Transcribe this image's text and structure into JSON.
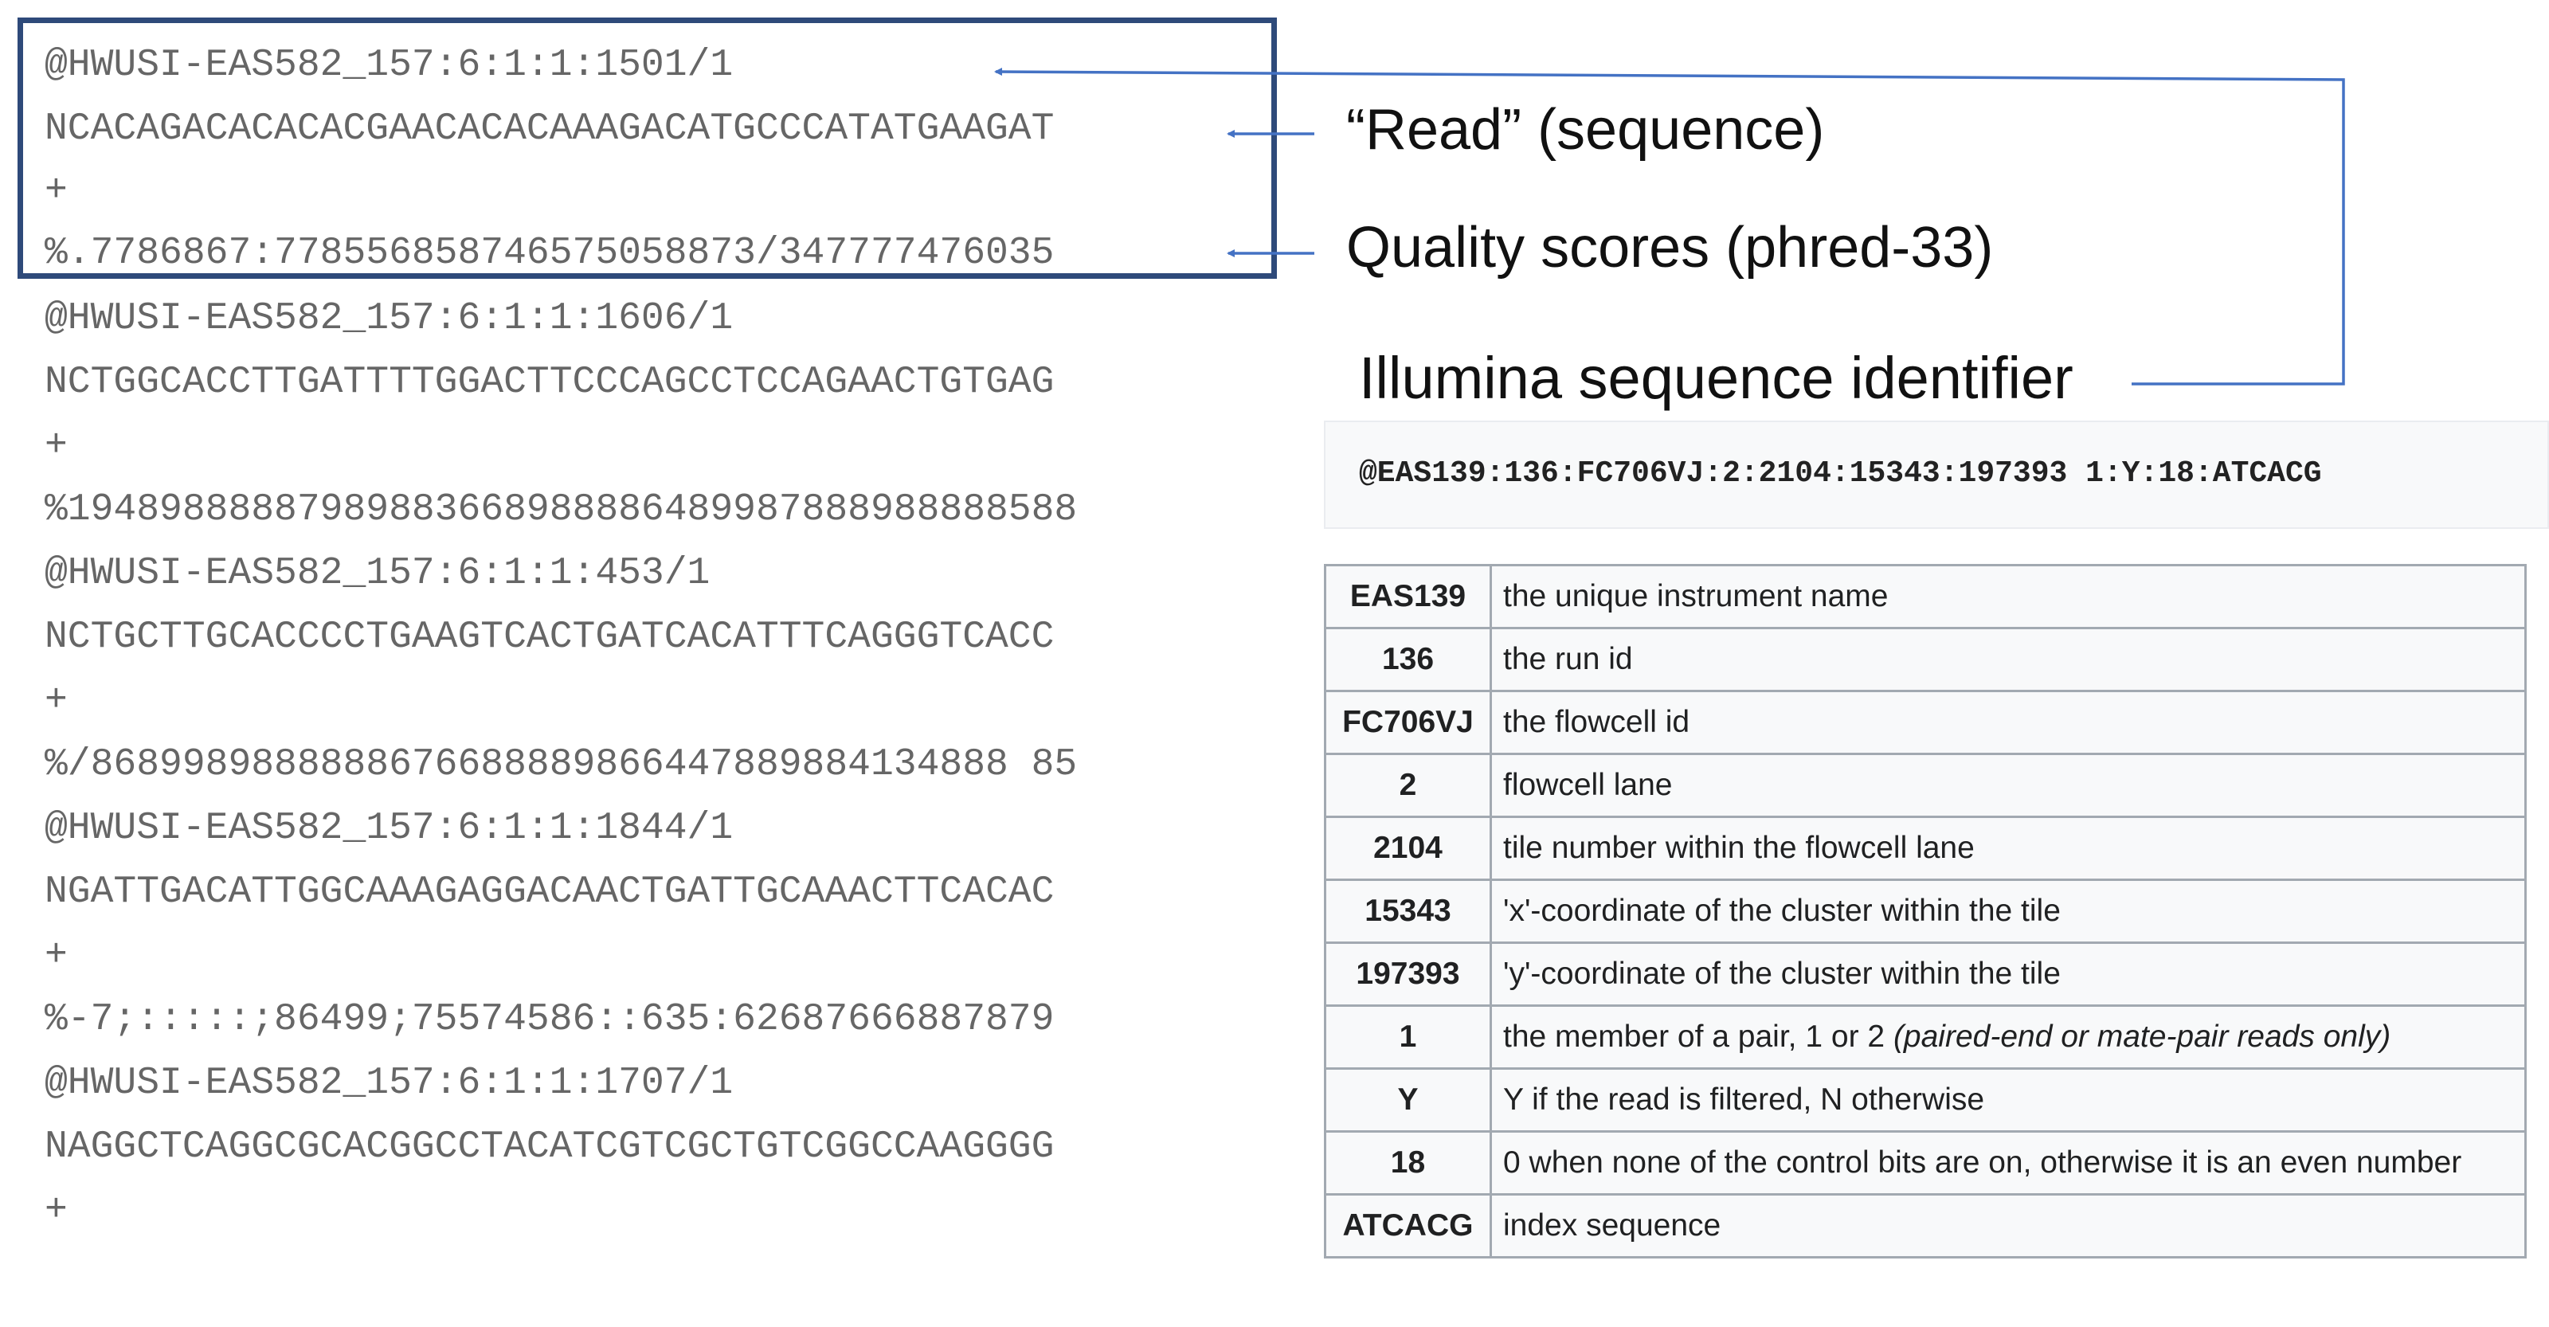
{
  "fastq": {
    "lines": [
      "@HWUSI-EAS582_157:6:1:1:1501/1",
      "NCACAGACACACACGAACACACAAAGACATGCCCATATGAAGAT",
      "+",
      "%.7786867:778556858746575058873/347777476035",
      "@HWUSI-EAS582_157:6:1:1:1606/1",
      "NCTGGCACCTTGATTTTGGACTTCCCAGCCTCCAGAACTGTGAG",
      "+",
      "%19489888887989883668988886489987888988888588",
      "@HWUSI-EAS582_157:6:1:1:453/1",
      "NCTGCTTGCACCCCTGAAGTCACTGATCACATTTCAGGGTCACC",
      "+",
      "%/8689989888888676688889866447889884134888 85",
      "@HWUSI-EAS582_157:6:1:1:1844/1",
      "NGATTGACATTGGCAAAGAGGACAACTGATTGCAAACTTCACAC",
      "+",
      "%-7;:::::;86499;75574586::635:62687666887879",
      "@HWUSI-EAS582_157:6:1:1:1707/1",
      "NAGGCTCAGGCGCACGGCCTACATCGTCGCTGTCGGCCAAGGGG",
      "+"
    ]
  },
  "annotations": {
    "read": "“Read” (sequence)",
    "quality": "Quality scores (phred-33)",
    "identifier": "Illumina sequence identifier"
  },
  "identifier_example": "@EAS139:136:FC706VJ:2:2104:15343:197393 1:Y:18:ATCACG",
  "fields": [
    {
      "key": "EAS139",
      "desc": "the unique instrument name"
    },
    {
      "key": "136",
      "desc": "the run id"
    },
    {
      "key": "FC706VJ",
      "desc": "the flowcell id"
    },
    {
      "key": "2",
      "desc": "flowcell lane"
    },
    {
      "key": "2104",
      "desc": "tile number within the flowcell lane"
    },
    {
      "key": "15343",
      "desc": "'x'-coordinate of the cluster within the tile"
    },
    {
      "key": "197393",
      "desc": "'y'-coordinate of the cluster within the tile"
    },
    {
      "key": "1",
      "desc": "the member of a pair, 1 or 2",
      "note": "(paired-end or mate-pair reads only)"
    },
    {
      "key": "Y",
      "desc": "Y if the read is filtered, N otherwise"
    },
    {
      "key": "18",
      "desc": "0 when none of the control bits are on, otherwise it is an even number"
    },
    {
      "key": "ATCACG",
      "desc": "index sequence"
    }
  ],
  "colors": {
    "box_border": "#2e4a7a",
    "arrow": "#4472c4",
    "monospace_text": "#666666"
  }
}
